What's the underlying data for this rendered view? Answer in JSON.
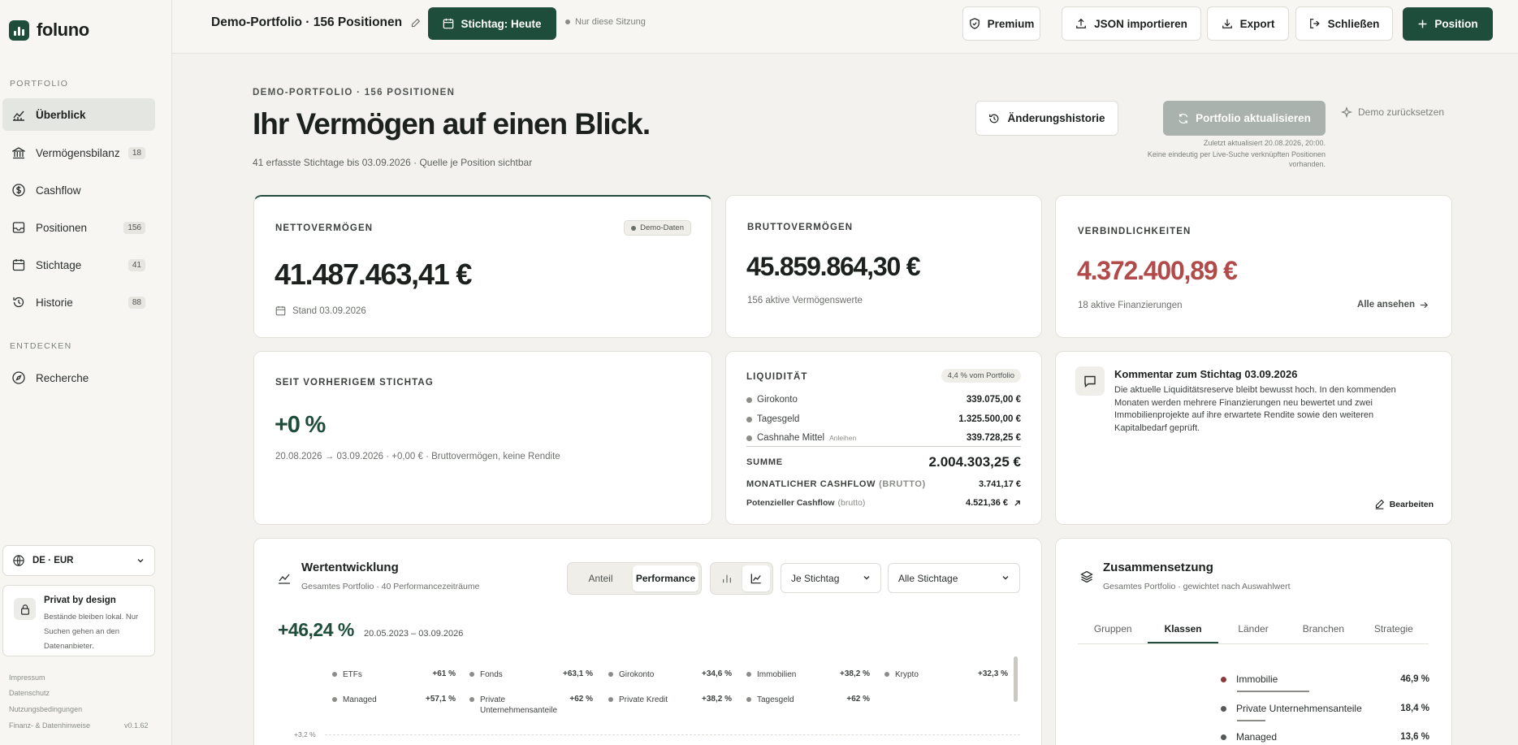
{
  "brand": {
    "name": "foluno"
  },
  "sidebar": {
    "section_portfolio": "PORTFOLIO",
    "section_discover": "ENTDECKEN",
    "items": [
      {
        "label": "Überblick",
        "icon": "chart-line-icon"
      },
      {
        "label": "Vermögensbilanz",
        "count": "18",
        "icon": "bank-icon"
      },
      {
        "label": "Cashflow",
        "icon": "dollar-icon"
      },
      {
        "label": "Positionen",
        "count": "156",
        "icon": "inbox-icon"
      },
      {
        "label": "Stichtage",
        "count": "41",
        "icon": "calendar-icon"
      },
      {
        "label": "Historie",
        "count": "88",
        "icon": "history-icon"
      },
      {
        "label": "Recherche",
        "icon": "compass-icon"
      }
    ],
    "locale": "DE · EUR",
    "privacy_title": "Privat by design",
    "privacy_text": "Bestände bleiben lokal. Nur Suchen gehen an den Datenanbieter.",
    "footer": [
      "Impressum",
      "Datenschutz",
      "Nutzungsbedingungen",
      "Finanz- & Datenhinweise"
    ],
    "version": "v0.1.62"
  },
  "topbar": {
    "portfolio_title": "Demo-Portfolio · 156 Positionen",
    "stichtag_button": "Stichtag: Heute",
    "session_note": "Nur diese Sitzung",
    "premium": "Premium",
    "import": "JSON importieren",
    "export": "Export",
    "close": "Schließen",
    "add_position": "Position"
  },
  "header": {
    "kicker": "DEMO-PORTFOLIO · 156 POSITIONEN",
    "title": "Ihr Vermögen auf einen Blick.",
    "subtitle": "41 erfasste Stichtage bis 03.09.2026 · Quelle je Position sichtbar",
    "history_button": "Änderungshistorie",
    "refresh_button": "Portfolio aktualisieren",
    "reset_button": "Demo zurücksetzen",
    "last_updated": "Zuletzt aktualisiert 20.08.2026, 20:00.",
    "refresh_note": "Keine eindeutig per Live-Suche verknüpften Positionen vorhanden."
  },
  "cards": {
    "net": {
      "label": "NETTOVERMÖGEN",
      "badge": "Demo-Daten",
      "value": "41.487.463,41 €",
      "date": "Stand 03.09.2026"
    },
    "gross": {
      "label": "BRUTTOVERMÖGEN",
      "value": "45.859.864,30 €",
      "note": "156 aktive Vermögenswerte"
    },
    "liab": {
      "label": "VERBINDLICHKEITEN",
      "value": "4.372.400,89 €",
      "note": "18 aktive Finanzierungen",
      "link": "Alle ansehen"
    },
    "change": {
      "label": "SEIT VORHERIGEM STICHTAG",
      "value": "+0 %",
      "note": "20.08.2026 → 03.09.2026 · +0,00 € · Bruttovermögen, keine Rendite"
    },
    "liquidity": {
      "label": "LIQUIDITÄT",
      "badge": "4,4 % vom Portfolio",
      "rows": [
        {
          "name": "Girokonto",
          "tag": "",
          "value": "339.075,00 €"
        },
        {
          "name": "Tagesgeld",
          "tag": "",
          "value": "1.325.500,00 €"
        },
        {
          "name": "Cashnahe Mittel",
          "tag": "Anleihen",
          "value": "339.728,25 €"
        }
      ],
      "sum_label": "SUMME",
      "sum_value": "2.004.303,25 €",
      "cashflow_label": "MONATLICHER CASHFLOW",
      "cashflow_qualifier": "(BRUTTO)",
      "cashflow_value": "3.741,17 €",
      "potential_label": "Potenzieller Cashflow",
      "potential_qualifier": "(brutto)",
      "potential_value": "4.521,36 €"
    },
    "comment": {
      "title": "Kommentar zum Stichtag 03.09.2026",
      "text": "Die aktuelle Liquiditätsreserve bleibt bewusst hoch. In den kommenden Monaten werden mehrere Finanzierungen neu bewertet und zwei Immobilienprojekte auf ihre erwartete Rendite sowie den weiteren Kapitalbedarf geprüft.",
      "edit": "Bearbeiten"
    }
  },
  "performance": {
    "title": "Wertentwicklung",
    "subtitle": "Gesamtes Portfolio · 40 Performancezeiträume",
    "toggle": [
      "Anteil",
      "Performance"
    ],
    "select_period": "Je Stichtag",
    "select_range": "Alle Stichtage",
    "value": "+46,24 %",
    "range": "20.05.2023 – 03.09.2026",
    "axis_top": "+3,2 %",
    "legend": [
      {
        "name": "ETFs",
        "value": "+61 %"
      },
      {
        "name": "Fonds",
        "value": "+63,1 %"
      },
      {
        "name": "Girokonto",
        "value": "+34,6 %"
      },
      {
        "name": "Immobilien",
        "value": "+38,2 %"
      },
      {
        "name": "Krypto",
        "value": "+32,3 %"
      },
      {
        "name": "Managed",
        "value": "+57,1 %"
      },
      {
        "name": "Private Unternehmensanteile",
        "value": "+62 %"
      },
      {
        "name": "Private Kredit",
        "value": "+38,2 %"
      },
      {
        "name": "Tagesgeld",
        "value": "+62 %"
      }
    ]
  },
  "composition": {
    "title": "Zusammensetzung",
    "subtitle": "Gesamtes Portfolio · gewichtet nach Auswahlwert",
    "tabs": [
      "Gruppen",
      "Klassen",
      "Länder",
      "Branchen",
      "Strategie"
    ],
    "active_tab": "Klassen",
    "rows": [
      {
        "name": "Immobilie",
        "value": "46,9 %",
        "share": 46.9,
        "color": "#8b3a3a"
      },
      {
        "name": "Private Unternehmensanteile",
        "value": "18,4 %",
        "share": 18.4,
        "color": "#555a56"
      },
      {
        "name": "Managed",
        "value": "13,6 %",
        "share": 13.6,
        "color": "#555a56"
      }
    ]
  },
  "colors": {
    "accent": "#1f4d3b",
    "negative": "#b24a4a",
    "positive": "#1f4d3b"
  }
}
